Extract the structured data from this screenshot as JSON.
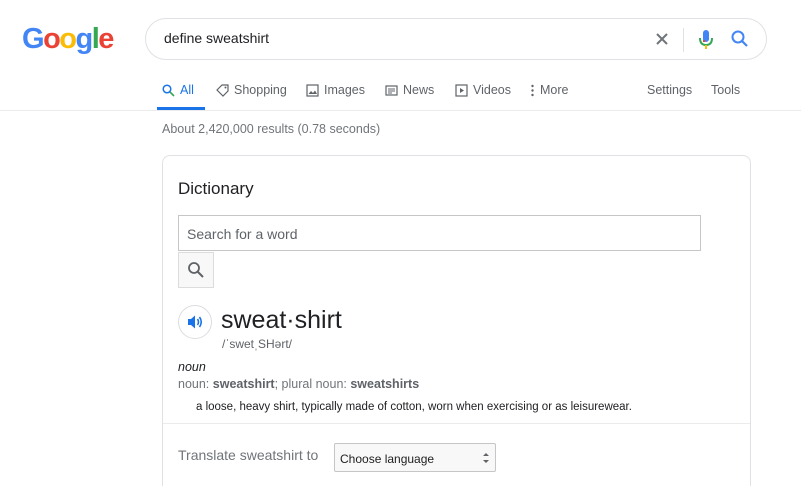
{
  "logo": {
    "letters": [
      "G",
      "o",
      "o",
      "g",
      "l",
      "e"
    ],
    "colors": [
      "#4285f4",
      "#ea4335",
      "#fbbc05",
      "#4285f4",
      "#34a853",
      "#ea4335"
    ]
  },
  "search": {
    "query": "define sweatshirt"
  },
  "tabs": [
    {
      "label": "All",
      "icon": "search-icon"
    },
    {
      "label": "Shopping",
      "icon": "tag-icon"
    },
    {
      "label": "Images",
      "icon": "image-icon"
    },
    {
      "label": "News",
      "icon": "news-icon"
    },
    {
      "label": "Videos",
      "icon": "video-icon"
    },
    {
      "label": "More",
      "icon": "more-vert-icon"
    }
  ],
  "tools": {
    "settings": "Settings",
    "tools": "Tools"
  },
  "stats": "About 2,420,000 results (0.78 seconds)",
  "dictionary": {
    "title": "Dictionary",
    "search_placeholder": "Search for a word",
    "headword": "sweat·shirt",
    "pronunciation": "/ˈswetˌSHərt/",
    "part_of_speech": "noun",
    "forms": {
      "prefix": "noun: ",
      "singular": "sweatshirt",
      "mid": "; plural noun: ",
      "plural": "sweatshirts"
    },
    "definition": "a loose, heavy shirt, typically made of cotton, worn when exercising or as leisurewear.",
    "translate_label": "Translate sweatshirt to",
    "language_select": "Choose language"
  },
  "colors": {
    "accent": "#1a73e8"
  }
}
